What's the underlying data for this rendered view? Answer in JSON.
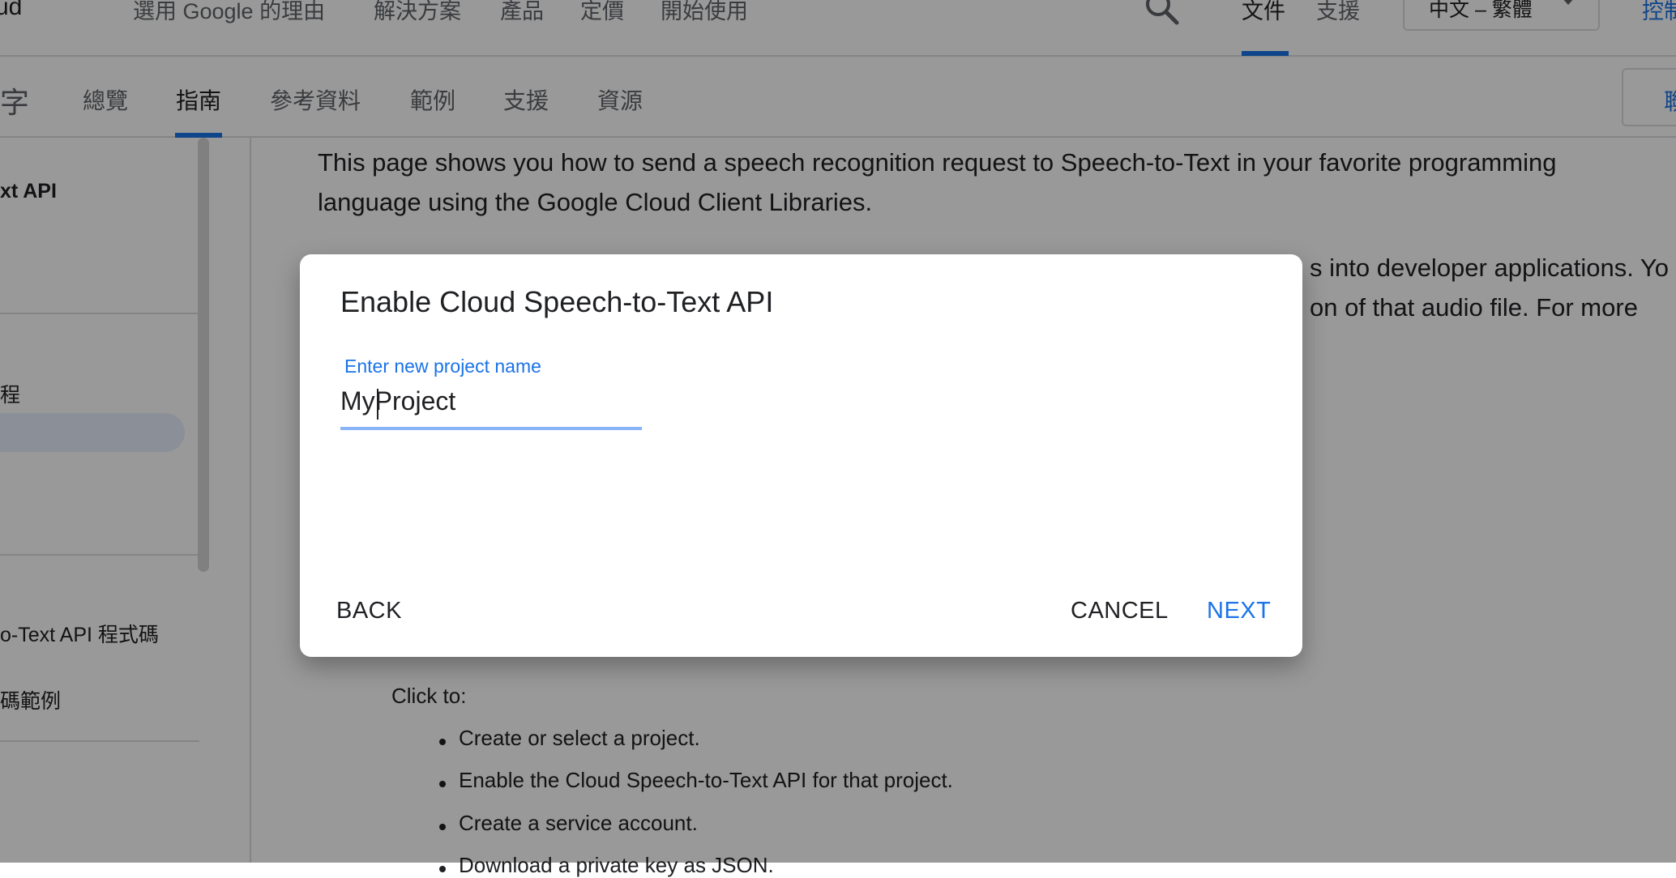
{
  "top_nav": {
    "brand_fragment": "ud",
    "items": [
      "選用 Google 的理由",
      "解決方案",
      "產品",
      "定價",
      "開始使用"
    ],
    "docs_label": "文件",
    "support_label": "支援",
    "language": "中文 – 繁體",
    "console_label": "控制"
  },
  "sub_nav": {
    "product_fragment": "字",
    "tabs": [
      "總覽",
      "指南",
      "參考資料",
      "範例",
      "支援",
      "資源"
    ],
    "active_tab": "指南",
    "contact_label": "聯"
  },
  "sidebar": {
    "heading": "xt API",
    "item_1": "程",
    "item_2": "o-Text API 程式碼",
    "item_3": "碼範例"
  },
  "content": {
    "intro_line_1": "This page shows you how to send a speech recognition request to Speech-to-Text in your favorite programming",
    "intro_line_2": "language using the Google Cloud Client Libraries.",
    "para2_line_1": "s into developer applications. Yo",
    "para2_line_2": "on of that audio file. For more",
    "click_to": "Click to:",
    "steps": [
      "Create or select a project.",
      "Enable the Cloud Speech-to-Text API for that project.",
      "Create a service account.",
      "Download a private key as JSON."
    ]
  },
  "dialog": {
    "title": "Enable Cloud Speech-to-Text API",
    "field_label": "Enter new project name",
    "field_value": "MyProject",
    "back_label": "BACK",
    "cancel_label": "CANCEL",
    "next_label": "NEXT"
  },
  "colors": {
    "accent": "#1a73e8",
    "field_underline": "#8ab4f8",
    "scrim": "rgba(0,0,0,0.4)"
  }
}
